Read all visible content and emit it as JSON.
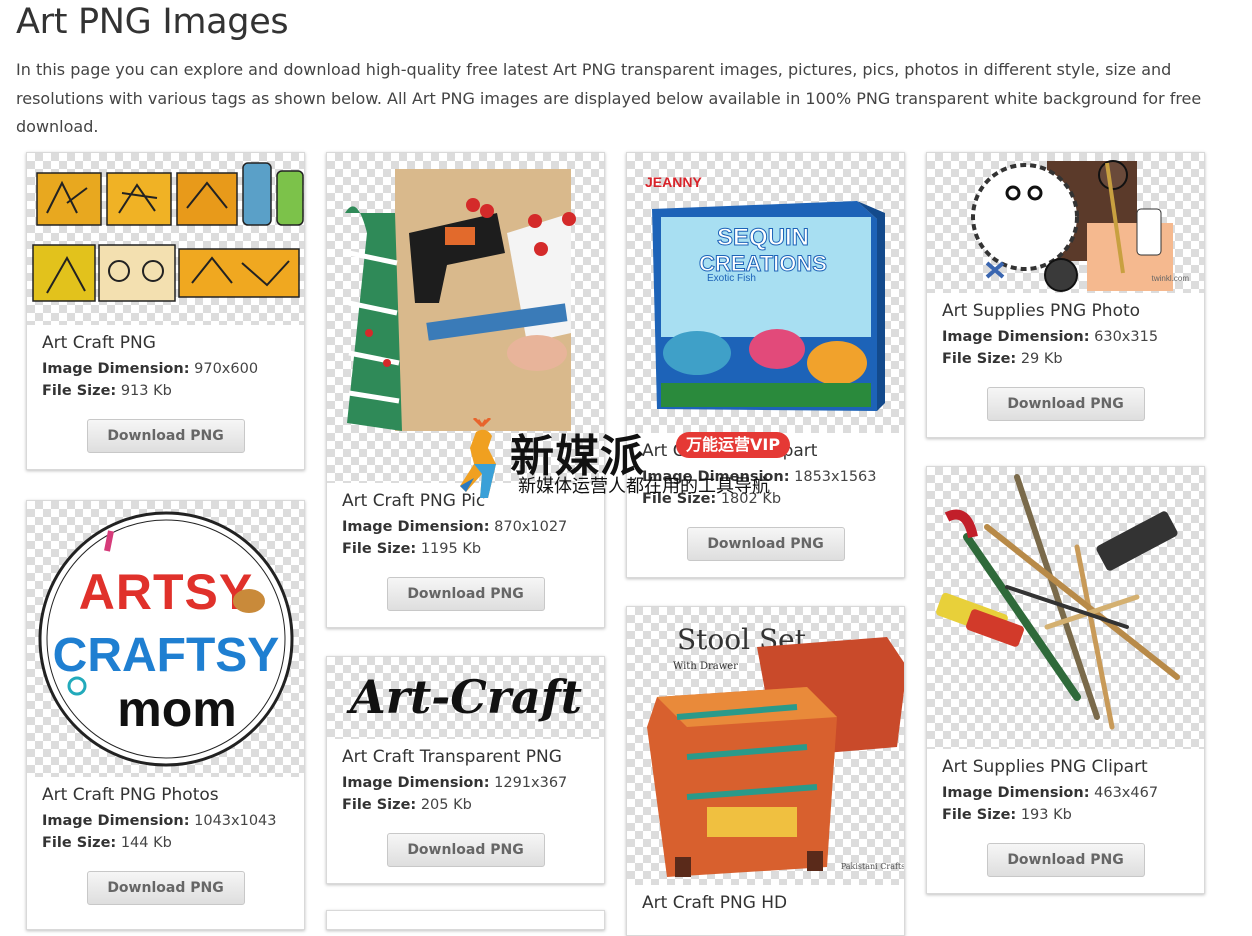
{
  "page": {
    "title": "Art PNG Images",
    "intro": "In this page you can explore and download high-quality free latest Art PNG transparent images, pictures, pics, photos in different style, size and resolutions with various tags as shown below. All Art PNG images are displayed below available in 100% PNG transparent white background for free download."
  },
  "labels": {
    "dimension": "Image Dimension:",
    "size": "File Size:",
    "download": "Download PNG"
  },
  "cards": [
    {
      "title": "Art Craft PNG",
      "dimension": "970x600",
      "size": "913 Kb"
    },
    {
      "title": "Art Craft PNG Photos",
      "dimension": "1043x1043",
      "size": "144 Kb"
    },
    {
      "title": "Art Craft PNG Pic",
      "dimension": "870x1027",
      "size": "1195 Kb"
    },
    {
      "title": "Art Craft Transparent PNG",
      "dimension": "1291x367",
      "size": "205 Kb"
    },
    {
      "title": "Art Craft PNG Clipart",
      "dimension": "1853x1563",
      "size": "1802 Kb"
    },
    {
      "title": "Art Craft PNG HD",
      "dimension": "",
      "size": ""
    },
    {
      "title": "Art Supplies PNG Photo",
      "dimension": "630x315",
      "size": "29 Kb"
    },
    {
      "title": "Art Supplies PNG Clipart",
      "dimension": "463x467",
      "size": "193 Kb"
    }
  ],
  "image_text": {
    "artsy_lines": [
      "ARTSY",
      "CRAFTSY",
      "mom"
    ],
    "art_craft_script": "Art-Craft",
    "box_brand": "JEANNY",
    "box_title_1": "SEQUIN",
    "box_title_2": "CREATIONS",
    "box_subtitle": "Exotic Fish",
    "stool_title": "Stool Set",
    "stool_subtitle": "With Drawer",
    "stool_brand": "Pakistani Crafts",
    "twinkl": "twinkl.com"
  },
  "watermark": {
    "title": "新媒派",
    "badge": "万能运营VIP",
    "subtitle": "新媒体运营人都在用的工具导航"
  }
}
